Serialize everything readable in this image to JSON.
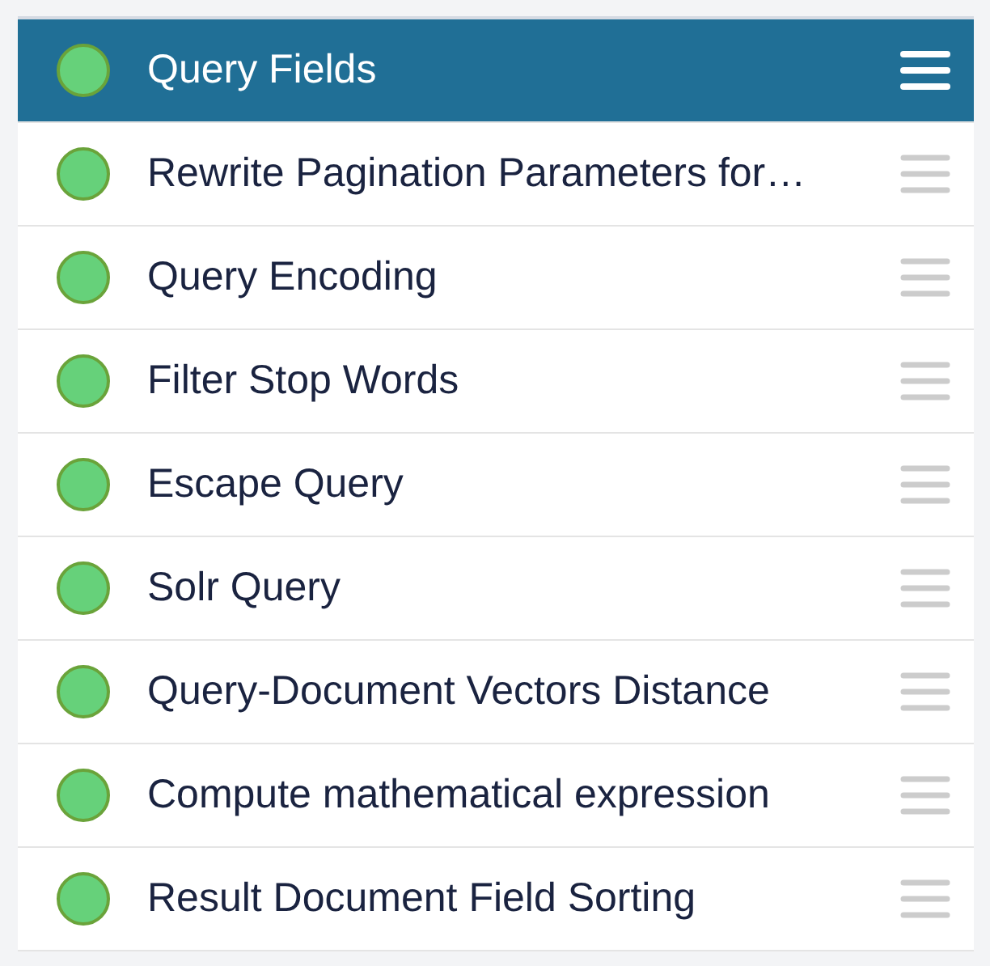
{
  "items": [
    {
      "label": "Query Fields",
      "selected": true,
      "color": "#66d17a"
    },
    {
      "label": "Rewrite Pagination Parameters for…",
      "selected": false,
      "color": "#66d17a"
    },
    {
      "label": "Query Encoding",
      "selected": false,
      "color": "#66d17a"
    },
    {
      "label": "Filter Stop Words",
      "selected": false,
      "color": "#66d17a"
    },
    {
      "label": "Escape Query",
      "selected": false,
      "color": "#66d17a"
    },
    {
      "label": "Solr Query",
      "selected": false,
      "color": "#66d17a"
    },
    {
      "label": "Query-Document Vectors Distance",
      "selected": false,
      "color": "#66d17a"
    },
    {
      "label": "Compute mathematical expression",
      "selected": false,
      "color": "#66d17a"
    },
    {
      "label": "Result Document Field Sorting",
      "selected": false,
      "color": "#66d17a"
    }
  ]
}
